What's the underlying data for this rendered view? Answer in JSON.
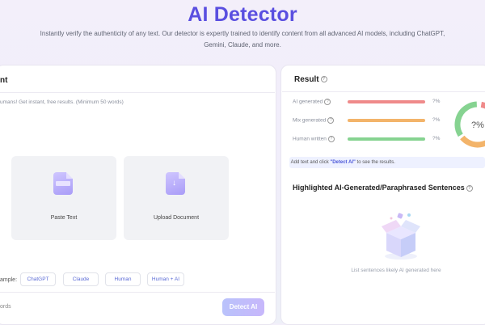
{
  "hero": {
    "title": "AI Detector",
    "subtitle": "Instantly verify the authenticity of any text. Our detector is expertly trained to identify content from all advanced AI models, including ChatGPT, Gemini, Claude, and more."
  },
  "left_panel": {
    "title": "nt",
    "hint": "umans! Get instant, free results. (Minimum 50 words)",
    "tiles": [
      {
        "label": "Paste Text",
        "icon": "paste-icon"
      },
      {
        "label": "Upload Document",
        "icon": "upload-document-icon"
      }
    ],
    "sample_label": "ample:",
    "samples": [
      "ChatGPT",
      "Claude",
      "Human",
      "Human + AI"
    ],
    "footer_text": "ords",
    "detect_button": "Detect AI"
  },
  "result": {
    "title": "Result",
    "metrics": [
      {
        "label": "AI generated",
        "value": "?%",
        "color": "#ef8a8a"
      },
      {
        "label": "Mix generated",
        "value": "?%",
        "color": "#f3b46a"
      },
      {
        "label": "Human written",
        "value": "?%",
        "color": "#86d391"
      }
    ],
    "donut_value": "?%",
    "notice_prefix": "Add text and click",
    "notice_action": "\"Detect AI\"",
    "notice_suffix": "to see the results.",
    "section_title": "Highlighted AI-Generated/Paraphrased Sentences",
    "empty_text": "List sentences likely AI generated here"
  }
}
